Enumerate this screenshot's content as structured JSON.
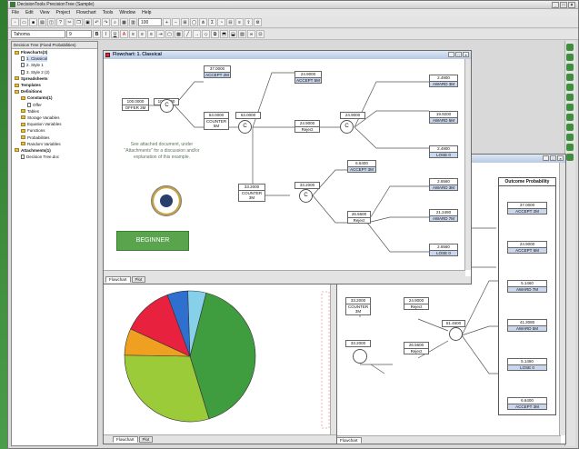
{
  "app": {
    "title": "DecisionTools PrecisionTree (Sample)",
    "menu": [
      "File",
      "Edit",
      "View",
      "Project",
      "Flowchart",
      "Tools",
      "Window",
      "Help"
    ],
    "zoom": "100",
    "font_name": "Tahoma",
    "font_size": "9"
  },
  "tree": {
    "header": "Decision Tree (Fixed Probabilities)",
    "items": [
      {
        "label": "Flowcharts(3)",
        "level": 0,
        "bold": true,
        "icon": "folder"
      },
      {
        "label": "1. Classical",
        "level": 1,
        "bold": false,
        "icon": "page",
        "selected": true
      },
      {
        "label": "2. Style 1",
        "level": 1,
        "bold": false,
        "icon": "page"
      },
      {
        "label": "3. Style 2 (2)",
        "level": 1,
        "bold": false,
        "icon": "page"
      },
      {
        "label": "Spreadsheets",
        "level": 0,
        "bold": true,
        "icon": "folder"
      },
      {
        "label": "Templates",
        "level": 0,
        "bold": true,
        "icon": "folder"
      },
      {
        "label": "Definitions",
        "level": 0,
        "bold": true,
        "icon": "folder"
      },
      {
        "label": "Constants(1)",
        "level": 1,
        "bold": true,
        "icon": "folder"
      },
      {
        "label": "Offer",
        "level": 2,
        "bold": false,
        "icon": "page"
      },
      {
        "label": "Tables",
        "level": 1,
        "bold": false,
        "icon": "folder"
      },
      {
        "label": "Storage Variables",
        "level": 1,
        "bold": false,
        "icon": "folder"
      },
      {
        "label": "Equation Variables",
        "level": 1,
        "bold": false,
        "icon": "folder"
      },
      {
        "label": "Functions",
        "level": 1,
        "bold": false,
        "icon": "folder"
      },
      {
        "label": "Probabilities",
        "level": 1,
        "bold": false,
        "icon": "folder"
      },
      {
        "label": "Random Variables",
        "level": 1,
        "bold": false,
        "icon": "folder"
      },
      {
        "label": "Attachments(1)",
        "level": 0,
        "bold": true,
        "icon": "folder"
      },
      {
        "label": "Decision Tree.doc",
        "level": 1,
        "bold": false,
        "icon": "page"
      }
    ]
  },
  "flow": {
    "title": "Flowchart: 1. Classical",
    "note": "See attached document, under \"Attachments\" for a discussion and/or explanation of this example.",
    "button": "BEGINNER",
    "tabs": [
      "Flowchart",
      "Plot"
    ],
    "nodes": {
      "offer": {
        "v": "100.0000",
        "l": "OFFER 3M"
      },
      "n1": "100.0000",
      "accept2m": {
        "v": "37.0000",
        "l": "ACCEPT 2M"
      },
      "accept5m": {
        "v": "24.9000",
        "l": "ACCEPT 5M"
      },
      "counter": {
        "v": "63.0000",
        "l": "COUNTER 5M"
      },
      "counterv": "63.0000",
      "reject": {
        "v": "24.9000",
        "l": "Reject"
      },
      "n2": "24.9000",
      "award3m": {
        "v": "2.4900",
        "l": "AWARD 3M"
      },
      "award5m": {
        "v": "19.9200",
        "l": "AWARD 5M"
      },
      "lose": {
        "v": "2.4900",
        "l": "LOSE 0"
      },
      "counter3m": {
        "v": "33.2000",
        "l": "COUNTER 3M"
      },
      "n3": "33.2000",
      "accept3m": {
        "v": "6.6400",
        "l": "ACCEPT 3M"
      },
      "reject2": {
        "v": "26.5600",
        "l": "Reject"
      },
      "award3m2": {
        "v": "2.6560",
        "l": "AWARD 3M"
      },
      "award7m": {
        "v": "21.2480",
        "l": "AWARD 7M"
      },
      "lose2": {
        "v": "2.6560",
        "l": "LOSE 0"
      }
    }
  },
  "outcome": {
    "header": "Outcome Probability",
    "items": [
      {
        "v": "37.0000",
        "l": "ACCEPT 2M"
      },
      {
        "v": "24.9000",
        "l": "ACCEPT 5M"
      },
      {
        "v": "5.1460",
        "l": "AWARD 7M"
      },
      {
        "v": "41.3080",
        "l": "AWARD 5M"
      },
      {
        "v": "5.1460",
        "l": "LOSE 0"
      },
      {
        "v": "6.6400",
        "l": "ACCEPT 3M"
      }
    ],
    "mid": {
      "c3": {
        "v": "33.2000",
        "l": "COUNTER 3M"
      },
      "c3v": "33.2000",
      "rej1": {
        "v": "24.9000",
        "l": "Reject"
      },
      "rej2": {
        "v": "26.5600",
        "l": "Reject"
      },
      "n": "51.4600"
    },
    "tabs": [
      "Flowchart"
    ]
  },
  "pie": {
    "tabs": [
      "Flowchart",
      "Plot"
    ],
    "slices": [
      {
        "value": 41.3,
        "color": "#3f9c3f"
      },
      {
        "value": 30.0,
        "color": "#9ccb3a"
      },
      {
        "value": 6.6,
        "color": "#f0a020"
      },
      {
        "value": 12.5,
        "color": "#e8213f"
      },
      {
        "value": 5.1,
        "color": "#2e6fd0"
      },
      {
        "value": 4.5,
        "color": "#86d0ea"
      }
    ]
  }
}
